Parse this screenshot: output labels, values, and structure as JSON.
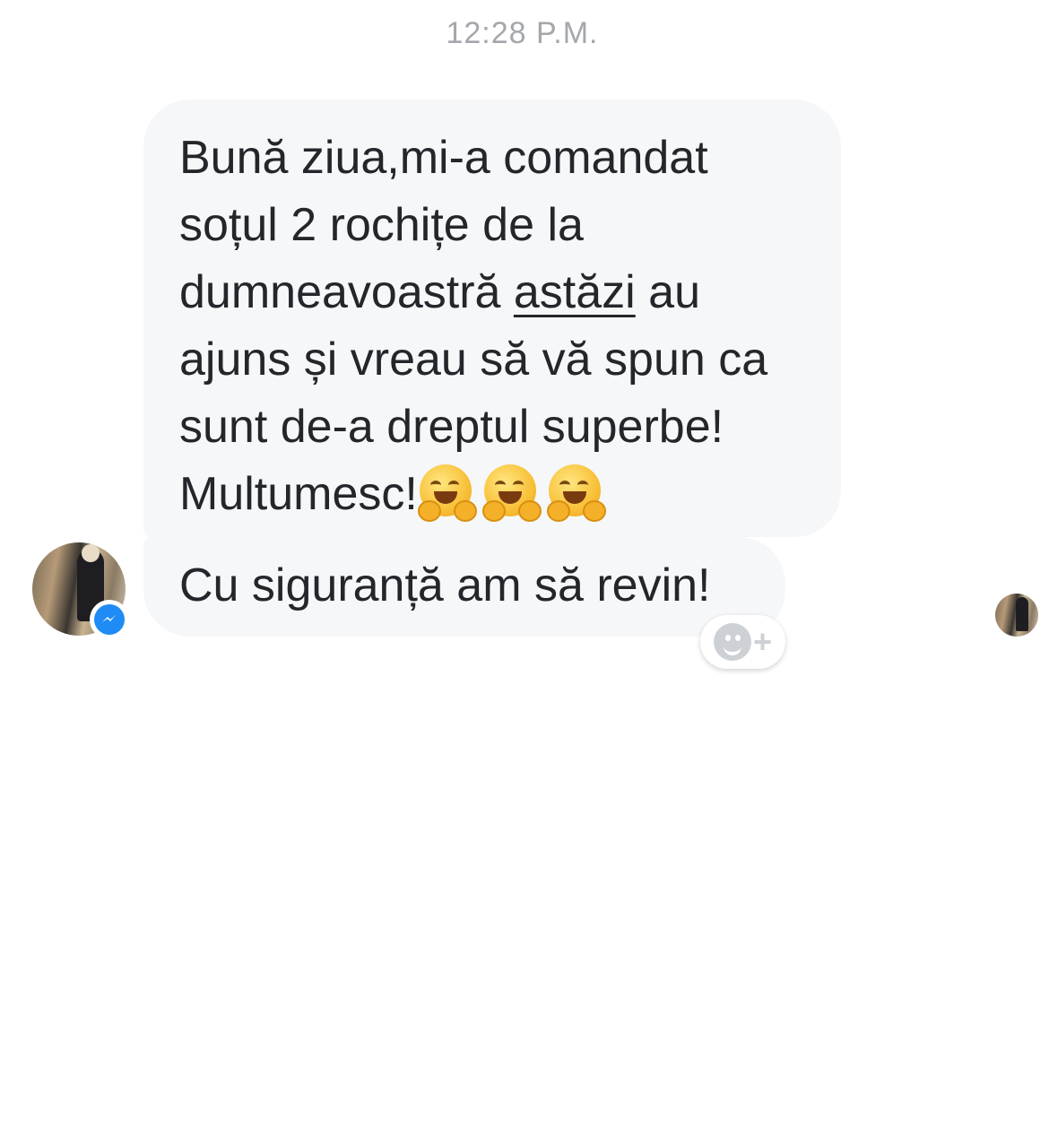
{
  "conversation": {
    "timestamp": "12:28 P.M.",
    "messages": [
      {
        "line1": "Bună ziua,mi-a comandat",
        "line2": "soțul 2 rochițe de la",
        "line3_before": "dumneavoastră ",
        "line3_link": "astăzi",
        "line3_after": " au",
        "line4": "ajuns și vreau să vă spun ca",
        "line5": "sunt de-a dreptul superbe!",
        "line6": "Multumesc!",
        "emoji": "hugging-face",
        "emoji_count": 3
      },
      {
        "text": "Cu siguranță am să revin!"
      }
    ]
  },
  "colors": {
    "bubble_bg": "#f6f7f9",
    "timestamp": "#a4a7ab",
    "messenger_blue": "#1f8cf5"
  },
  "icons": {
    "badge": "messenger-icon",
    "reaction": "add-reaction-icon"
  }
}
